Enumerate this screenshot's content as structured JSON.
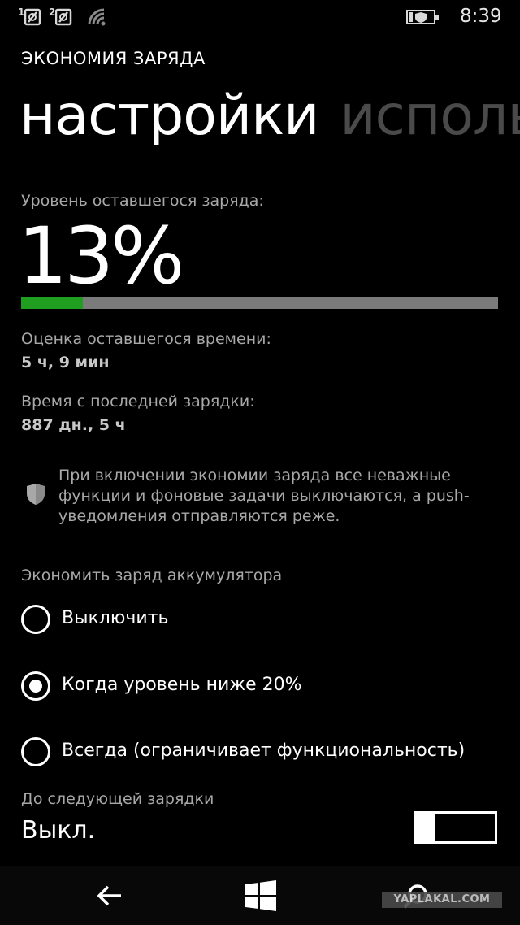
{
  "status_bar": {
    "sim1_label": "1",
    "sim2_label": "2",
    "time": "8:39",
    "icons": [
      "sim1-signal-icon",
      "sim2-signal-icon",
      "wifi-icon",
      "battery-saver-icon"
    ]
  },
  "header": {
    "app_title": "ЭКОНОМИЯ ЗАРЯДА",
    "pivot_active": "настройки",
    "pivot_next": "исполь"
  },
  "battery": {
    "level_label": "Уровень оставшегося заряда:",
    "level_text": "13%",
    "level_fraction": 0.13,
    "fill_color": "#1f9e1f",
    "track_color": "#7b7b7b",
    "estimate_label": "Оценка оставшегося времени:",
    "estimate_value": "5 ч, 9 мин",
    "since_label": "Время с последней зарядки:",
    "since_value": "887 дн., 5 ч"
  },
  "info": {
    "icon": "shield-icon",
    "text": "При включении экономии заряда все неважные функции и фоновые задачи выключаются, а push-уведомления отправляются реже."
  },
  "saver": {
    "label": "Экономить заряд аккумулятора",
    "options": [
      {
        "label": "Выключить",
        "selected": false
      },
      {
        "label": "Когда уровень ниже 20%",
        "selected": true
      },
      {
        "label": "Всегда (ограничивает функциональность)",
        "selected": false
      }
    ]
  },
  "until_next": {
    "label": "До следующей зарядки",
    "state": "Выкл.",
    "on": false
  },
  "nav": {
    "icons": [
      "back-icon",
      "windows-icon",
      "search-icon"
    ]
  },
  "watermark": "YAPLAKAL.COM"
}
